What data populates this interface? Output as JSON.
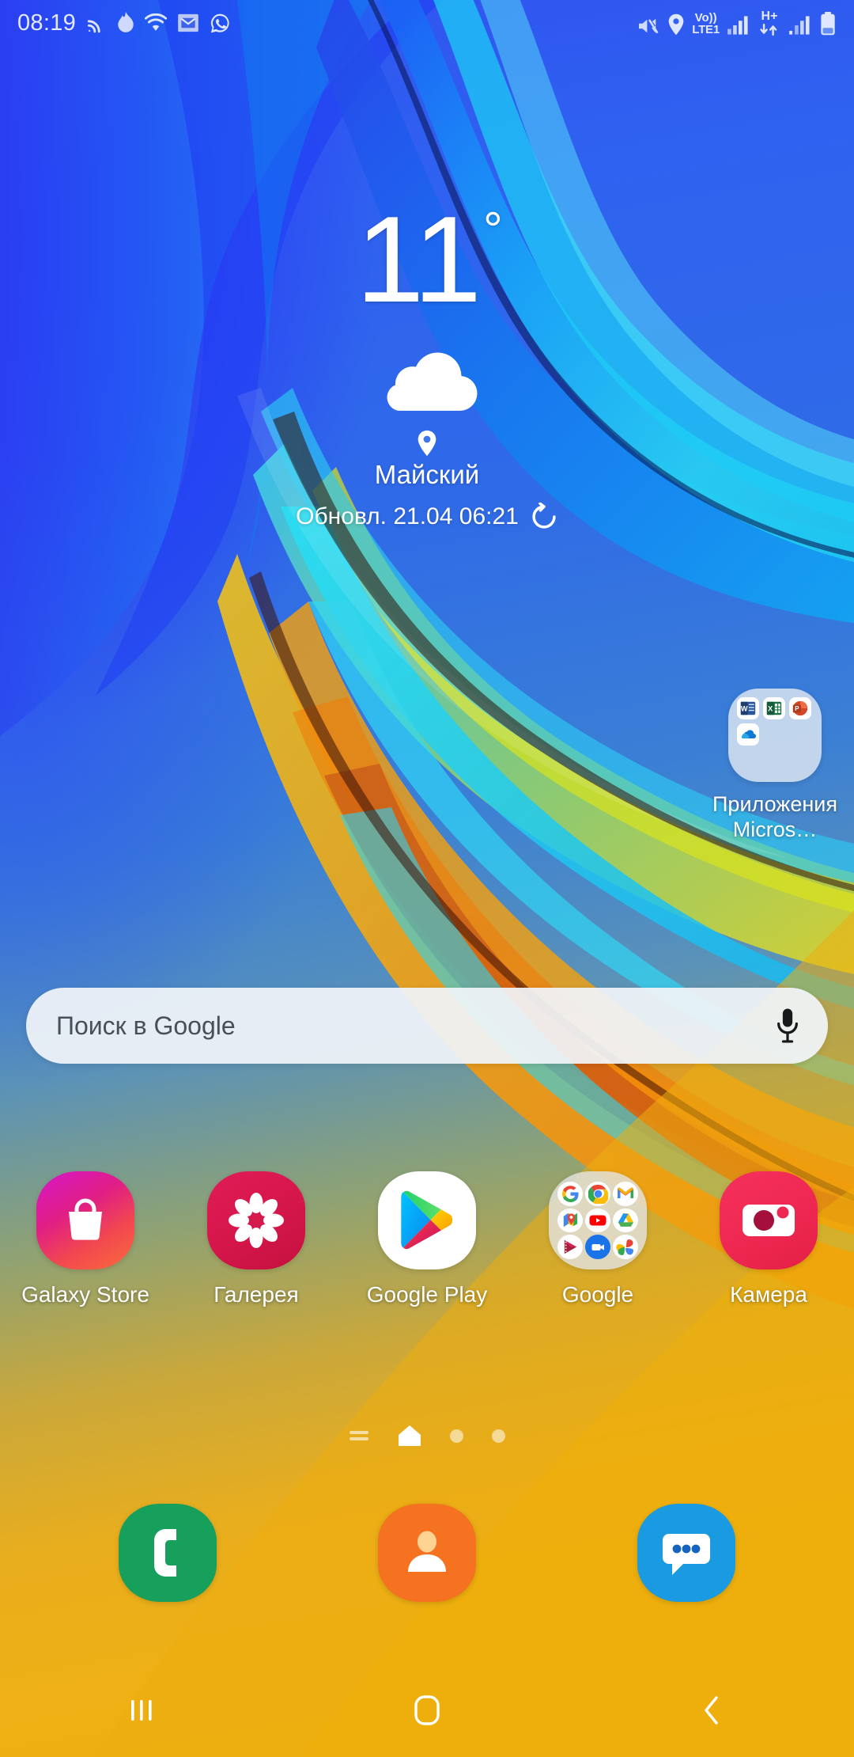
{
  "statusbar": {
    "clock": "08:19",
    "left_icons": [
      "cast-icon",
      "flame-icon",
      "wifi-icon",
      "mail-icon",
      "whatsapp-icon"
    ],
    "right_icons": [
      "mute-icon",
      "location-icon",
      "signal-1-icon",
      "data-arrows-icon",
      "signal-2-icon",
      "battery-icon"
    ],
    "volte_top": "Vo))",
    "volte_bottom": "LTE1",
    "network_type": "H+"
  },
  "weather": {
    "temperature": "11",
    "degree_symbol": "°",
    "condition_icon": "cloud-icon",
    "location_icon": "location-pin-icon",
    "location": "Майский",
    "updated": "Обновл. 21.04 06:21",
    "refresh_icon": "refresh-icon"
  },
  "ms_folder": {
    "label": "Приложения Micros…",
    "apps": [
      "word-icon",
      "excel-icon",
      "powerpoint-icon",
      "onedrive-icon"
    ]
  },
  "search": {
    "placeholder": "Поиск в Google",
    "mic_icon": "microphone-icon"
  },
  "apps": [
    {
      "label": "Galaxy Store",
      "icon": "galaxy-store-icon"
    },
    {
      "label": "Галерея",
      "icon": "gallery-icon"
    },
    {
      "label": "Google Play",
      "icon": "google-play-icon"
    },
    {
      "label": "Google",
      "icon": "google-folder-icon"
    },
    {
      "label": "Камера",
      "icon": "camera-icon"
    }
  ],
  "google_folder_apps": [
    "google-search-icon",
    "chrome-icon",
    "gmail-icon",
    "maps-icon",
    "youtube-icon",
    "drive-icon",
    "play-movies-icon",
    "meet-icon",
    "photos-icon"
  ],
  "page_indicator": {
    "items": [
      "feed-page-icon",
      "home-page-icon",
      "dot-page-3",
      "dot-page-4"
    ],
    "active_index": 1
  },
  "dock": [
    {
      "label": "phone",
      "icon": "phone-icon"
    },
    {
      "label": "contacts",
      "icon": "contacts-icon"
    },
    {
      "label": "messages",
      "icon": "messages-icon"
    }
  ],
  "navbar": {
    "recents_icon": "recents-icon",
    "home_icon": "home-icon",
    "back_icon": "back-icon"
  },
  "colors": {
    "wallpaper_blue": "#2f62f0",
    "wallpaper_yellow": "#eead0c",
    "galaxy_store_pink": "#e0218a",
    "gallery_crimson": "#d6194c",
    "camera_red": "#ef2a52",
    "phone_green": "#17a05c",
    "contacts_orange": "#f57320",
    "messages_blue": "#1a9ae0",
    "search_bg": "#f1f4f9"
  }
}
